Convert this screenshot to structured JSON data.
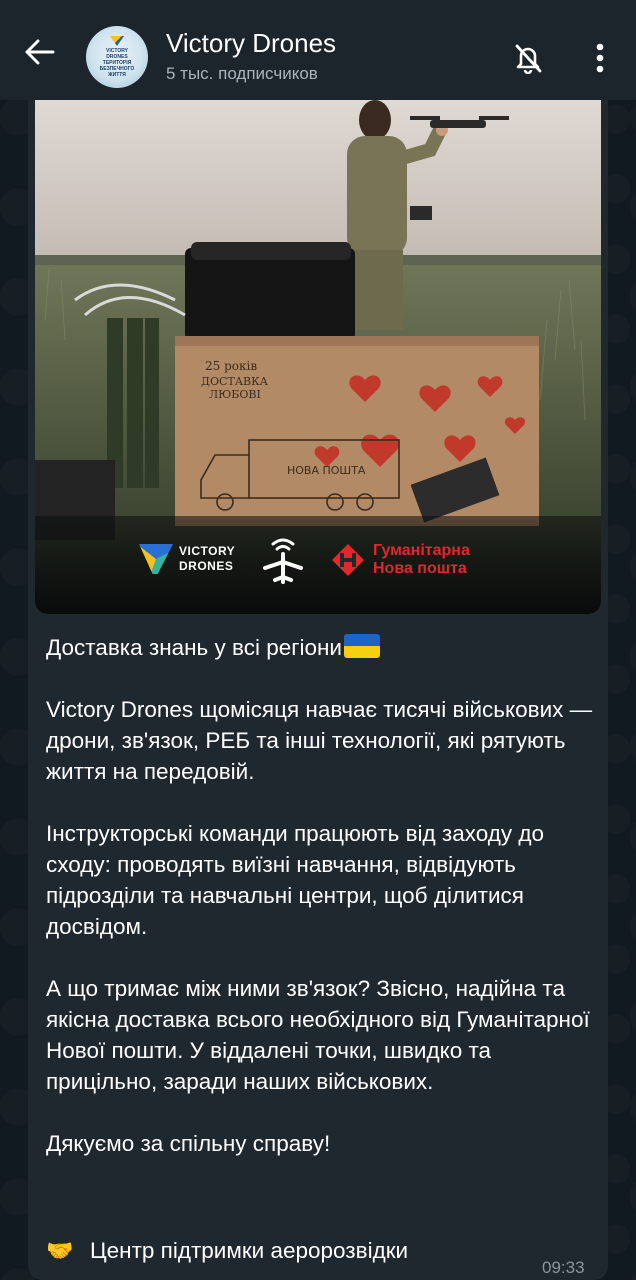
{
  "header": {
    "channel_title": "Victory Drones",
    "subscribers": "5 тыс. подписчиков",
    "avatar_text": "VICTORY DRONES ТЕРИТОРІЯ БЕЗПЕЧНОГО ЖИТТЯ",
    "icons": [
      "back-arrow-icon",
      "notifications-off-icon",
      "more-vertical-icon"
    ]
  },
  "photo": {
    "box_text_line1": "25 років",
    "box_text_line2": "ДОСТАВКА",
    "box_text_line3": "ЛЮБОВІ",
    "truck_text": "НОВА ПОШТА",
    "logo_vd_line1": "VICTORY",
    "logo_vd_line2": "DRONES",
    "logo_np_line1": "Гуманітарна",
    "logo_np_line2": "Нова пошта"
  },
  "message": {
    "title": "Доставка знань у всі регіони",
    "p1": "Victory Drones щомісяця навчає тисячі військових — дрони, зв'язок, РЕБ та інші технології, які рятують життя на передовій.",
    "p2": "Інструкторські команди працюють від заходу до сходу: проводять виїзні навчання, відвідують підрозділи та навчальні центри, щоб ділитися досвідом.",
    "p3": "А що тримає між ними зв'язок? Звісно, надійна та якісна доставка всього необхідного від Гуманітарної Нової пошти. У віддалені точки, швидко та прицільно, заради наших військових.",
    "p4": "Дякуємо за спільну справу!",
    "signature": "Центр підтримки аеророзвідки",
    "time": "09:33"
  },
  "colors": {
    "header_bg": "#1c242c",
    "bubble_bg": "#1f272f",
    "chat_bg": "#111a20",
    "np_red": "#e2282b",
    "ua_blue": "#1e64c8",
    "ua_yellow": "#f6cf0f"
  }
}
